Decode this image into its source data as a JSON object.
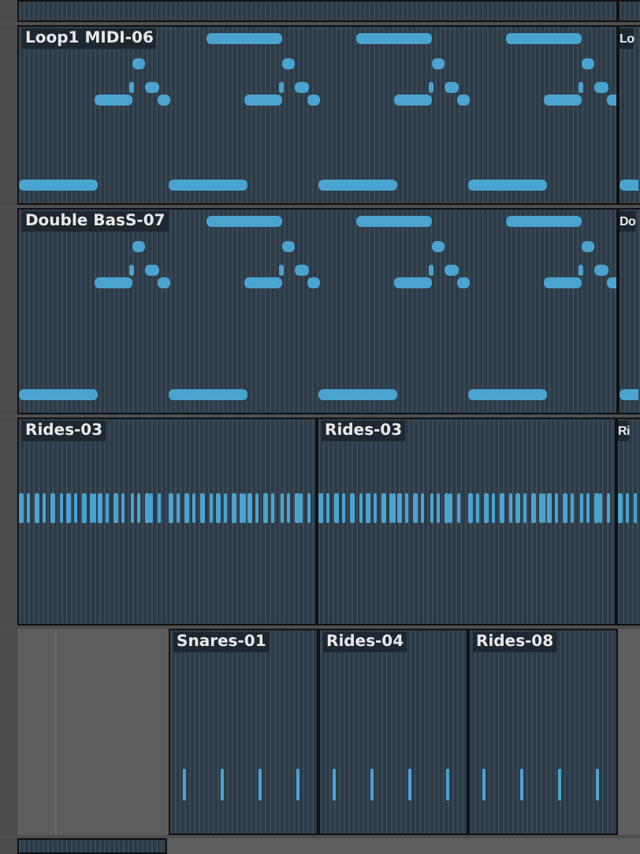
{
  "tracks": [
    {
      "kind": "loop",
      "clips": [
        {
          "kind": "empty"
        },
        {
          "kind": "empty"
        }
      ]
    },
    {
      "kind": "loop",
      "clips": [
        {
          "label": "Loop1 MIDI-06",
          "kind": "bass"
        },
        {
          "label": "Lo",
          "kind": "bass"
        }
      ]
    },
    {
      "kind": "loop",
      "clips": [
        {
          "label": "Double BasS-07",
          "kind": "bass"
        },
        {
          "label": "Do",
          "kind": "bass"
        }
      ]
    },
    {
      "kind": "split",
      "clips": [
        {
          "label": "Rides-03",
          "kind": "rides"
        },
        {
          "label": "Rides-03",
          "kind": "rides"
        },
        {
          "label": "Ri",
          "kind": "rides"
        }
      ]
    },
    {
      "kind": "late",
      "clips": [
        {
          "label": "Snares-01",
          "kind": "hits"
        },
        {
          "label": "Rides-04",
          "kind": "hits"
        },
        {
          "label": "Rides-08",
          "kind": "hits"
        }
      ]
    },
    {
      "kind": "tail",
      "clips": [
        {
          "kind": "empty"
        }
      ]
    }
  ]
}
